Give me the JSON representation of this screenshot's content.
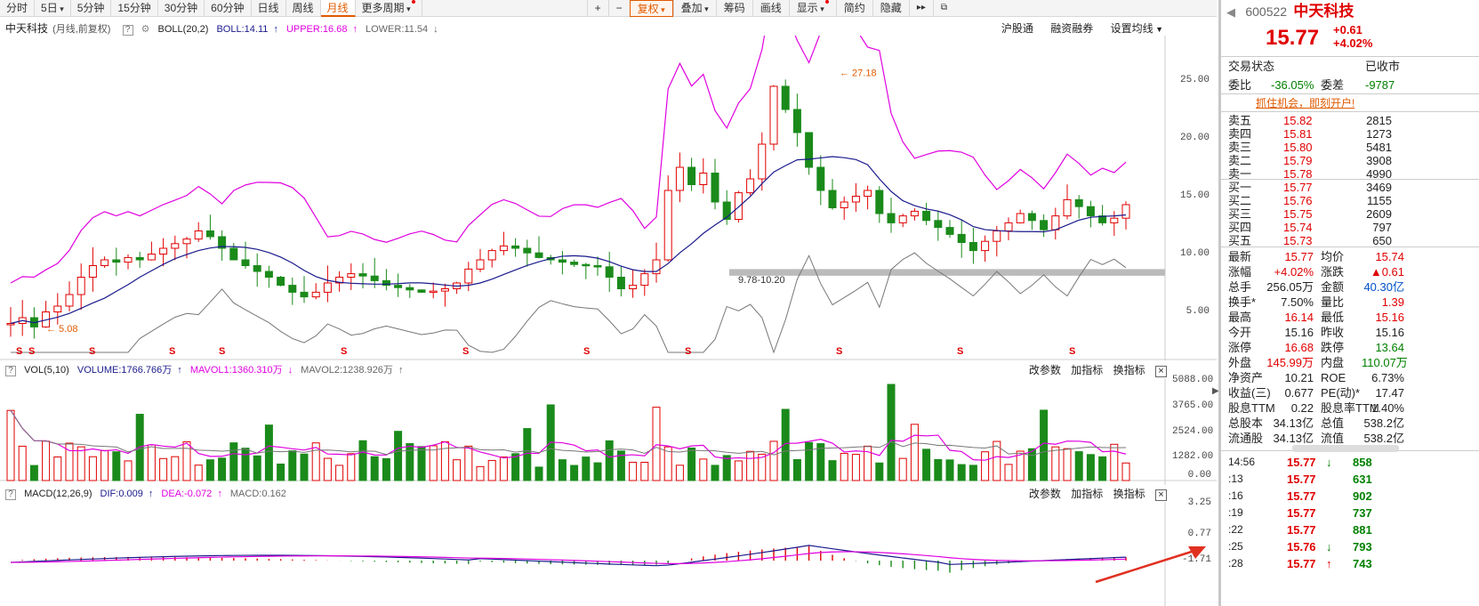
{
  "toolbar": {
    "tabs": [
      "分时",
      "5日",
      "5分钟",
      "15分钟",
      "30分钟",
      "60分钟",
      "日线",
      "周线",
      "月线",
      "更多周期"
    ],
    "active_tab": "月线",
    "right": [
      "+",
      "−",
      "复权",
      "叠加",
      "筹码",
      "画线",
      "显示",
      "简约",
      "隐藏"
    ],
    "right_icons": [
      "play-icon",
      "popout-icon"
    ]
  },
  "header": {
    "stock_name": "中天科技",
    "period_info": "(月线,前复权)",
    "indicator_title": "BOLL(20,2)",
    "boll_label": "BOLL:",
    "boll_value": "14.11",
    "upper_label": "UPPER:",
    "upper_value": "16.68",
    "lower_label": "LOWER:",
    "lower_value": "11.54",
    "buttons": [
      "沪股通",
      "融资融券",
      "设置均线"
    ]
  },
  "main_chart": {
    "y_labels": [
      "25.00",
      "20.00",
      "15.00",
      "10.00",
      "5.00"
    ],
    "high_label": "27.18",
    "low_label": "5.08",
    "band_label": "9.78-10.20",
    "s_marker": "S"
  },
  "vol_panel": {
    "title": "VOL(5,10)",
    "volume_label": "VOLUME:",
    "volume_value": "1766.766万",
    "mavol1_label": "MAVOL1:",
    "mavol1_value": "1360.310万",
    "mavol2_label": "MAVOL2:",
    "mavol2_value": "1238.926万",
    "y_labels": [
      "5088.00",
      "3765.00",
      "2524.00",
      "1282.00",
      "0.00"
    ],
    "buttons": [
      "改参数",
      "加指标",
      "换指标"
    ]
  },
  "macd_panel": {
    "title": "MACD(12,26,9)",
    "dif_label": "DIF:",
    "dif_value": "0.009",
    "dea_label": "DEA:",
    "dea_value": "-0.072",
    "macd_label": "MACD:",
    "macd_value": "0.162",
    "y_labels": [
      "3.25",
      "0.77",
      "-1.71"
    ],
    "buttons": [
      "改参数",
      "加指标",
      "换指标"
    ]
  },
  "quote": {
    "code": "600522",
    "name": "中天科技",
    "price": "15.77",
    "change": "+0.61",
    "change_pct": "+4.02%",
    "status_label": "交易状态",
    "status_value": "已收市",
    "weibi_label": "委比",
    "weibi_value": "-36.05%",
    "weicha_label": "委差",
    "weicha_value": "-9787",
    "promo": "抓住机会，即刻开户!",
    "asks": [
      {
        "label": "卖五",
        "price": "15.82",
        "vol": "2815"
      },
      {
        "label": "卖四",
        "price": "15.81",
        "vol": "1273"
      },
      {
        "label": "卖三",
        "price": "15.80",
        "vol": "5481"
      },
      {
        "label": "卖二",
        "price": "15.79",
        "vol": "3908"
      },
      {
        "label": "卖一",
        "price": "15.78",
        "vol": "4990"
      }
    ],
    "bids": [
      {
        "label": "买一",
        "price": "15.77",
        "vol": "3469"
      },
      {
        "label": "买二",
        "price": "15.76",
        "vol": "1155"
      },
      {
        "label": "买三",
        "price": "15.75",
        "vol": "2609"
      },
      {
        "label": "买四",
        "price": "15.74",
        "vol": "797"
      },
      {
        "label": "买五",
        "price": "15.73",
        "vol": "650"
      }
    ],
    "stats": [
      {
        "l1": "最新",
        "v1": "15.77",
        "c1": "red",
        "l2": "均价",
        "v2": "15.74",
        "c2": "red"
      },
      {
        "l1": "涨幅",
        "v1": "+4.02%",
        "c1": "red",
        "l2": "涨跌",
        "v2": "▲0.61",
        "c2": "red"
      },
      {
        "l1": "总手",
        "v1": "256.05万",
        "c1": "dark",
        "l2": "金额",
        "v2": "40.30亿",
        "c2": "blue"
      },
      {
        "l1": "换手*",
        "v1": "7.50%",
        "c1": "dark",
        "l2": "量比",
        "v2": "1.39",
        "c2": "red"
      },
      {
        "l1": "最高",
        "v1": "16.14",
        "c1": "red",
        "l2": "最低",
        "v2": "15.16",
        "c2": "red"
      },
      {
        "l1": "今开",
        "v1": "15.16",
        "c1": "dark",
        "l2": "昨收",
        "v2": "15.16",
        "c2": "dark"
      },
      {
        "l1": "涨停",
        "v1": "16.68",
        "c1": "red",
        "l2": "跌停",
        "v2": "13.64",
        "c2": "green"
      },
      {
        "l1": "外盘",
        "v1": "145.99万",
        "c1": "red",
        "l2": "内盘",
        "v2": "110.07万",
        "c2": "green"
      },
      {
        "l1": "净资产",
        "v1": "10.21",
        "c1": "dark",
        "l2": "ROE",
        "v2": "6.73%",
        "c2": "dark"
      },
      {
        "l1": "收益(三)",
        "v1": "0.677",
        "c1": "dark",
        "l2": "PE(动)*",
        "v2": "17.47",
        "c2": "dark"
      },
      {
        "l1": "股息TTM",
        "v1": "0.22",
        "c1": "dark",
        "l2": "股息率TTM",
        "v2": "1.40%",
        "c2": "dark"
      },
      {
        "l1": "总股本",
        "v1": "34.13亿",
        "c1": "dark",
        "l2": "总值",
        "v2": "538.2亿",
        "c2": "dark"
      },
      {
        "l1": "流通股",
        "v1": "34.13亿",
        "c1": "dark",
        "l2": "流值",
        "v2": "538.2亿",
        "c2": "dark"
      }
    ],
    "ticks": [
      {
        "time": "14:56",
        "price": "15.77",
        "vol": "858",
        "dir": "down"
      },
      {
        "time": ":13",
        "price": "15.77",
        "vol": "631",
        "dir": ""
      },
      {
        "time": ":16",
        "price": "15.77",
        "vol": "902",
        "dir": ""
      },
      {
        "time": ":19",
        "price": "15.77",
        "vol": "737",
        "dir": ""
      },
      {
        "time": ":22",
        "price": "15.77",
        "vol": "881",
        "dir": ""
      },
      {
        "time": ":25",
        "price": "15.76",
        "vol": "793",
        "dir": "down"
      },
      {
        "time": ":28",
        "price": "15.77",
        "vol": "743",
        "dir": "up"
      }
    ]
  }
}
